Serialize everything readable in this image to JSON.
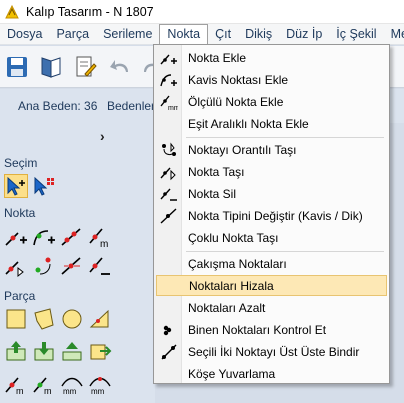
{
  "window": {
    "title": "Kalıp Tasarım - N 1807"
  },
  "menubar": {
    "items": [
      {
        "label": "Dosya",
        "active": false
      },
      {
        "label": "Parça",
        "active": false
      },
      {
        "label": "Serileme",
        "active": false
      },
      {
        "label": "Nokta",
        "active": true
      },
      {
        "label": "Çıt",
        "active": false
      },
      {
        "label": "Dikiş",
        "active": false
      },
      {
        "label": "Düz İp",
        "active": false
      },
      {
        "label": "İç Şekil",
        "active": false
      },
      {
        "label": "Metin",
        "active": false
      }
    ]
  },
  "infostrip": {
    "ana_beden": "Ana Beden: 36",
    "bedenler": "Bedenler:"
  },
  "leftpanel": {
    "secim_label": "Seçim",
    "nokta_label": "Nokta",
    "parca_label": "Parça",
    "chevron": "›"
  },
  "dropdown": {
    "items": [
      {
        "label": "Nokta Ekle",
        "icon": "point-add-icon"
      },
      {
        "label": "Kavis Noktası Ekle",
        "icon": "curve-point-add-icon"
      },
      {
        "label": "Ölçülü Nokta Ekle",
        "icon": "measured-point-add-icon"
      },
      {
        "label": "Eşit Aralıklı Nokta Ekle",
        "icon": ""
      },
      {
        "label": "Noktayı Orantılı Taşı",
        "icon": "proportional-move-icon"
      },
      {
        "label": "Nokta Taşı",
        "icon": "point-move-icon"
      },
      {
        "label": "Nokta Sil",
        "icon": "point-delete-icon"
      },
      {
        "label": "Nokta Tipini Değiştir (Kavis / Dik)",
        "icon": "point-type-icon"
      },
      {
        "label": "Çoklu Nokta Taşı",
        "icon": ""
      },
      {
        "label": "Çakışma Noktaları",
        "icon": ""
      },
      {
        "label": "Noktaları Hizala",
        "icon": ""
      },
      {
        "label": "Noktaları Azalt",
        "icon": ""
      },
      {
        "label": "Binen Noktaları Kontrol Et",
        "icon": "overlap-check-icon"
      },
      {
        "label": "Seçili İki Noktayı Üst Üste Bindir",
        "icon": "merge-points-icon"
      },
      {
        "label": "Köşe Yuvarlama",
        "icon": ""
      }
    ],
    "highlighted_index": 10
  },
  "colors": {
    "accent": "#fde8b5",
    "panel": "#dbe3ee",
    "menu_text": "#1e395b"
  }
}
